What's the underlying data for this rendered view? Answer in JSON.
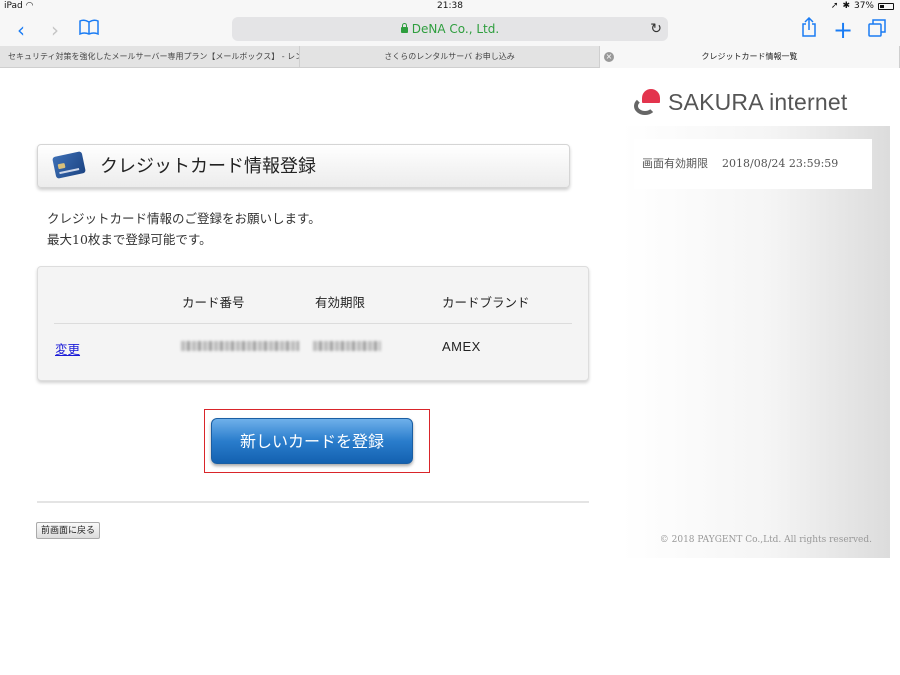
{
  "status_bar": {
    "device": "iPad",
    "time": "21:38",
    "battery": "37%"
  },
  "toolbar": {
    "url": "DeNA Co., Ltd."
  },
  "tabs": [
    {
      "title": "セキュリティ対策を強化したメールサーバー専用プラン【メールボックス】 - レン…"
    },
    {
      "title": "さくらのレンタルサーバ お申し込み"
    },
    {
      "title": "クレジットカード情報一覧",
      "active": true
    }
  ],
  "sidebar": {
    "logo_text": "SAKURA internet",
    "expiry_label": "画面有効期限",
    "expiry_value": "2018/08/24 23:59:59",
    "copyright": "© 2018 PAYGENT Co.,Ltd. All rights reserved."
  },
  "main": {
    "heading": "クレジットカード情報登録",
    "intro_line1": "クレジットカード情報のご登録をお願いします。",
    "intro_line2": "最大10枚まで登録可能です。",
    "table": {
      "headers": [
        "カード番号",
        "有効期限",
        "カードブランド"
      ],
      "rows": [
        {
          "action": "変更",
          "card_number": "(blurred)",
          "expiry": "(blurred)",
          "brand": "AMEX"
        }
      ]
    },
    "register_button": "新しいカードを登録",
    "back_button": "前画面に戻る"
  },
  "colors": {
    "accent_blue": "#2a7dcc",
    "highlight_red": "#d9252a",
    "url_green": "#2e9e3e"
  }
}
